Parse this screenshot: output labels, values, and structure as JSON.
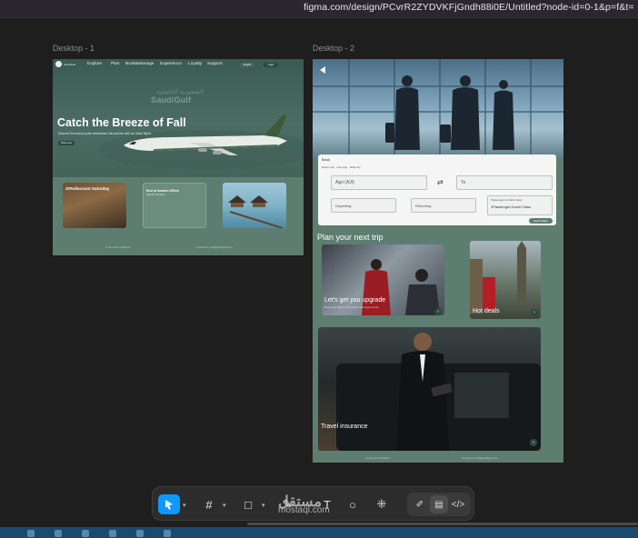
{
  "browser": {
    "url": "figma.com/design/PCvrR2ZYDVKFjGndh88i0E/Untitled?node-id=0-1&p=f&t="
  },
  "frames": {
    "desktop1": {
      "label": "Desktop - 1",
      "logo_text": "SaudiGulf",
      "nav": [
        "Explore",
        "Plan",
        "Book&Manage",
        "Experience",
        "Loyalty",
        "Support"
      ],
      "nav_buttons": [
        "English",
        "Login"
      ],
      "brand_script": "السعودية الخليجية",
      "brand": "SaudiGulf",
      "headline": "Catch the Breeze of Fall",
      "subtext": "Discover the most popular destinations this autumn with our direct flights",
      "cta": "Book now",
      "cards": [
        {
          "title": "20%discount Saturday",
          "subtitle": ""
        },
        {
          "title": "End of season Offers",
          "subtitle": "Specific countries"
        },
        {
          "title": "",
          "subtitle": ""
        }
      ],
      "footer": [
        "Terms and Conditions",
        "Contact us: info@saudigulf.com"
      ]
    },
    "desktop2": {
      "label": "Desktop - 2",
      "booking": {
        "title": "Book",
        "options": [
          "Return trip",
          "One way",
          "Multi-city"
        ],
        "from": "Agri (AJI)",
        "to": "To",
        "departing": "Departing",
        "returning": "Returning",
        "passengers_label": "Passengers & cabin class",
        "passengers": "1Passenger,Guest Class",
        "search": "Search flights"
      },
      "section_title": "Plan your next trip",
      "tiles": [
        {
          "label": "Let's get you upgrade",
          "sub": "Book your flight in first class and enjoy luxury"
        },
        {
          "label": "Hot deals",
          "sub": ""
        },
        {
          "label": "Travel insurance",
          "sub": ""
        }
      ],
      "footer": [
        "Terms and Conditions",
        "Contact us: info@saudigulf.com"
      ]
    }
  },
  "toolbar": {
    "tools": [
      "move-tool",
      "frame-tool",
      "shape-tool",
      "pen-tool",
      "text-tool",
      "comment-tool",
      "actions-tool"
    ],
    "modes": [
      "design-mode",
      "dev-mode",
      "code-view"
    ]
  },
  "watermark": {
    "arabic": "مستقل",
    "latin": "mostaql.com"
  },
  "colors": {
    "accent": "#0d99ff",
    "frame_bg": "#5e7d71",
    "canvas": "#1e1e1e"
  }
}
